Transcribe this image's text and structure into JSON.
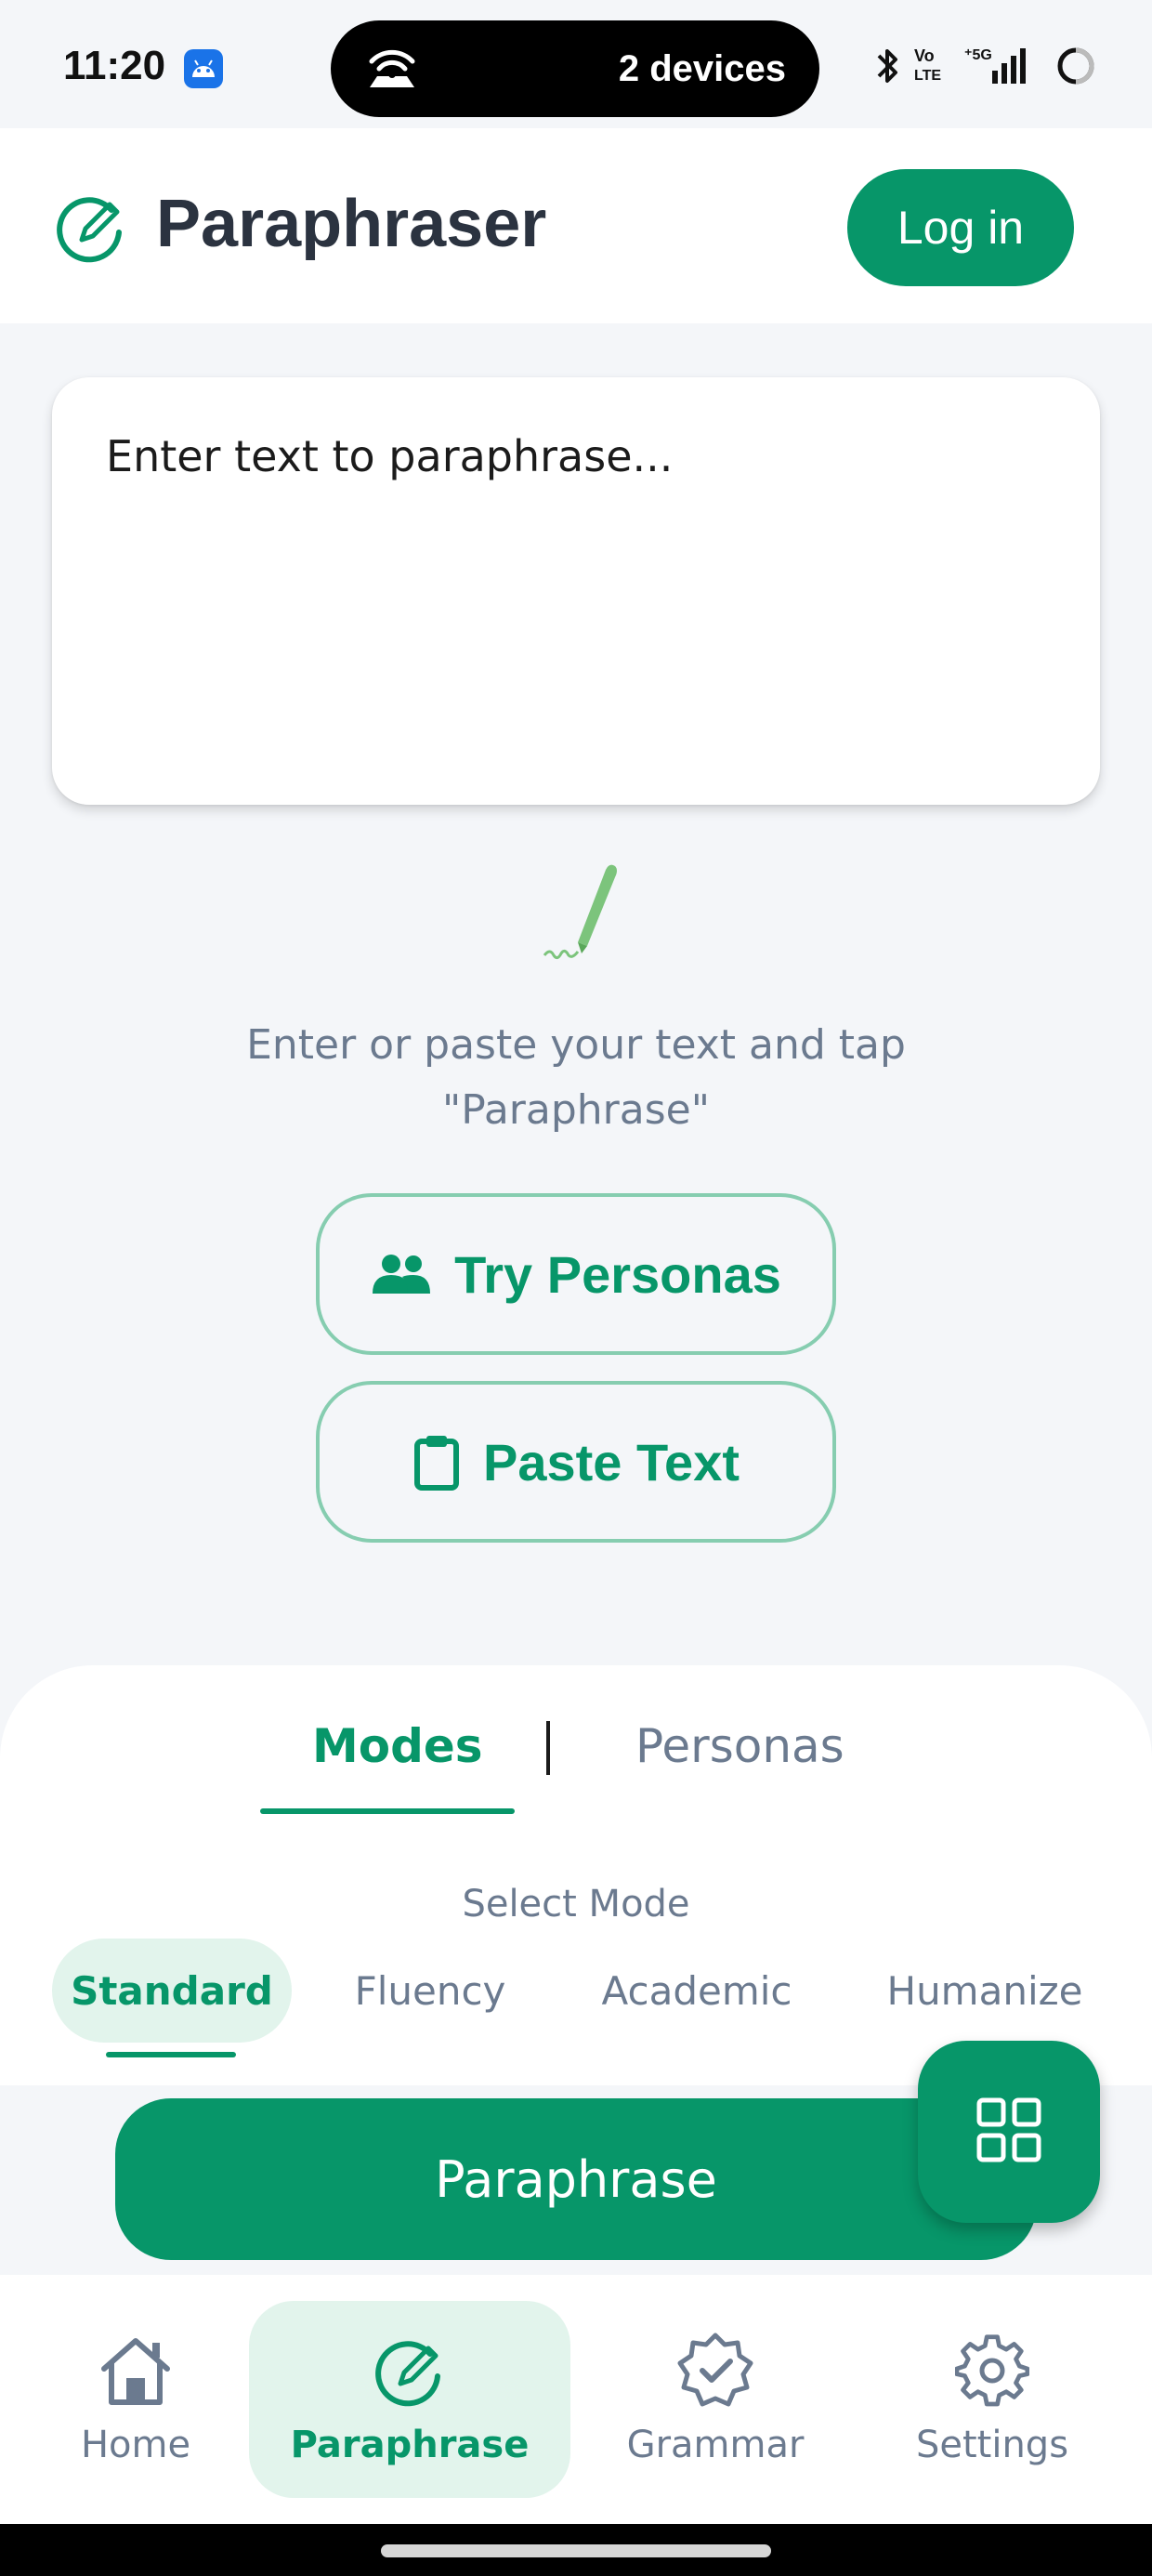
{
  "status_bar": {
    "time": "11:20",
    "devices_text": "2 devices",
    "icons": [
      "android-app-icon",
      "hotspot-icon",
      "bluetooth-icon",
      "volte-icon",
      "signal-5g-icon",
      "battery-icon"
    ]
  },
  "header": {
    "title": "Paraphraser",
    "login_label": "Log in",
    "logo_icon": "paraphrase-logo-icon"
  },
  "input": {
    "placeholder": "Enter text to paraphrase...",
    "value": ""
  },
  "empty_state": {
    "hint": "Enter or paste your text and tap \"Paraphrase\"",
    "try_personas_label": "Try Personas",
    "paste_text_label": "Paste Text"
  },
  "sheet": {
    "tabs": [
      {
        "label": "Modes",
        "active": true
      },
      {
        "label": "Personas",
        "active": false
      }
    ],
    "select_mode_label": "Select Mode",
    "modes": [
      {
        "label": "Standard",
        "active": true
      },
      {
        "label": "Fluency",
        "active": false
      },
      {
        "label": "Academic",
        "active": false
      },
      {
        "label": "Humanize",
        "active": false
      }
    ]
  },
  "actions": {
    "paraphrase_label": "Paraphrase",
    "fab_icon": "grid-icon"
  },
  "bottom_nav": [
    {
      "label": "Home",
      "icon": "home-icon",
      "active": false
    },
    {
      "label": "Paraphrase",
      "icon": "paraphrase-icon",
      "active": true
    },
    {
      "label": "Grammar",
      "icon": "grammar-check-icon",
      "active": false
    },
    {
      "label": "Settings",
      "icon": "gear-icon",
      "active": false
    }
  ],
  "colors": {
    "primary": "#079669",
    "primary_light": "#e2f4ec",
    "outline": "#86cdb0",
    "muted_text": "#6b7a8f",
    "background": "#f4f6f9"
  }
}
